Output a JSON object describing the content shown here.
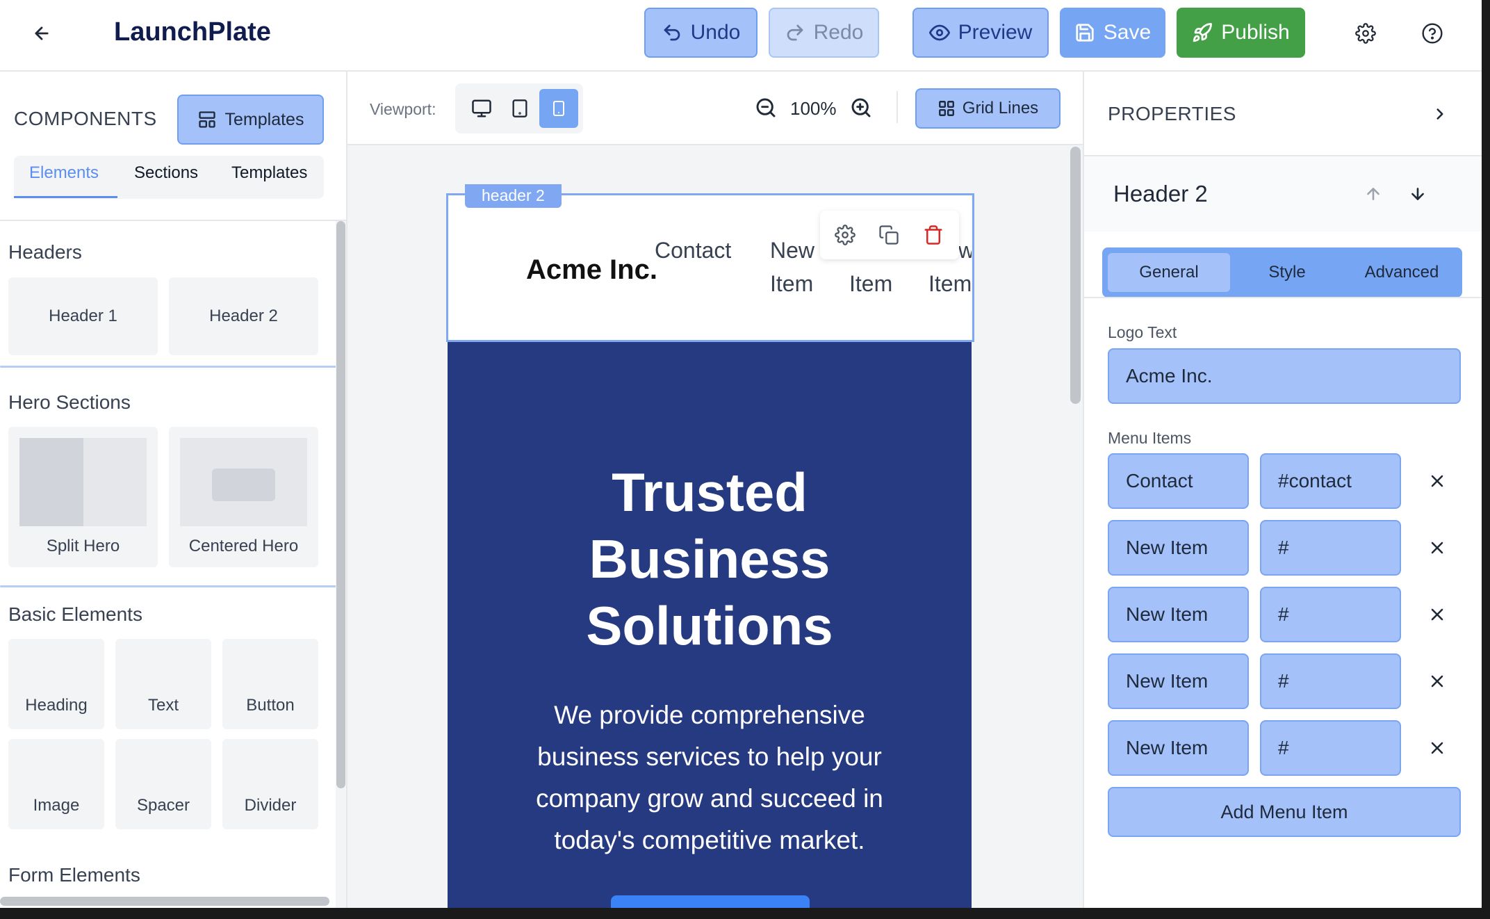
{
  "app": {
    "title": "LaunchPlate"
  },
  "toolbar": {
    "undo_label": "Undo",
    "redo_label": "Redo",
    "preview_label": "Preview",
    "save_label": "Save",
    "publish_label": "Publish"
  },
  "left_panel": {
    "title": "COMPONENTS",
    "templates_button": "Templates",
    "tabs": [
      "Elements",
      "Sections",
      "Templates"
    ],
    "active_tab": "Elements",
    "groups": {
      "headers": {
        "title": "Headers",
        "items": [
          "Header 1",
          "Header 2"
        ]
      },
      "hero": {
        "title": "Hero Sections",
        "items": [
          "Split Hero",
          "Centered Hero"
        ]
      },
      "basic": {
        "title": "Basic Elements",
        "items": [
          "Heading",
          "Text",
          "Button",
          "Image",
          "Spacer",
          "Divider"
        ]
      },
      "form": {
        "title": "Form Elements"
      }
    }
  },
  "canvas_toolbar": {
    "viewport_label": "Viewport:",
    "viewports": [
      "desktop-icon",
      "tablet-icon",
      "mobile-icon"
    ],
    "active_viewport": "mobile",
    "zoom": "100%",
    "grid_button": "Grid Lines"
  },
  "canvas": {
    "selected_tag": "header 2",
    "header": {
      "logo": "Acme Inc.",
      "menu_texts": {
        "contact": "Contact",
        "new1": "New",
        "item1": "Item",
        "item2": "Item",
        "partial_w": "w",
        "item3": "Item"
      }
    },
    "hero": {
      "title_lines": [
        "Trusted",
        "Business",
        "Solutions"
      ],
      "body_lines": [
        "We provide comprehensive",
        "business services to help your",
        "company grow and succeed in",
        "today's competitive market."
      ]
    }
  },
  "right_panel": {
    "title": "PROPERTIES",
    "component_name": "Header 2",
    "tabs": [
      "General",
      "Style",
      "Advanced"
    ],
    "active_tab": "General",
    "logo_text_label": "Logo Text",
    "logo_text_value": "Acme Inc.",
    "menu_items_label": "Menu Items",
    "menu_items": [
      {
        "label": "Contact",
        "link": "#contact"
      },
      {
        "label": "New Item",
        "link": "#"
      },
      {
        "label": "New Item",
        "link": "#"
      },
      {
        "label": "New Item",
        "link": "#"
      },
      {
        "label": "New Item",
        "link": "#"
      }
    ],
    "add_button": "Add Menu Item"
  },
  "colors": {
    "accent": "#a4c2f9",
    "accent_border": "#6f9ef0",
    "publish": "#43a047",
    "hero_bg": "#263a82",
    "danger": "#dc2626"
  }
}
